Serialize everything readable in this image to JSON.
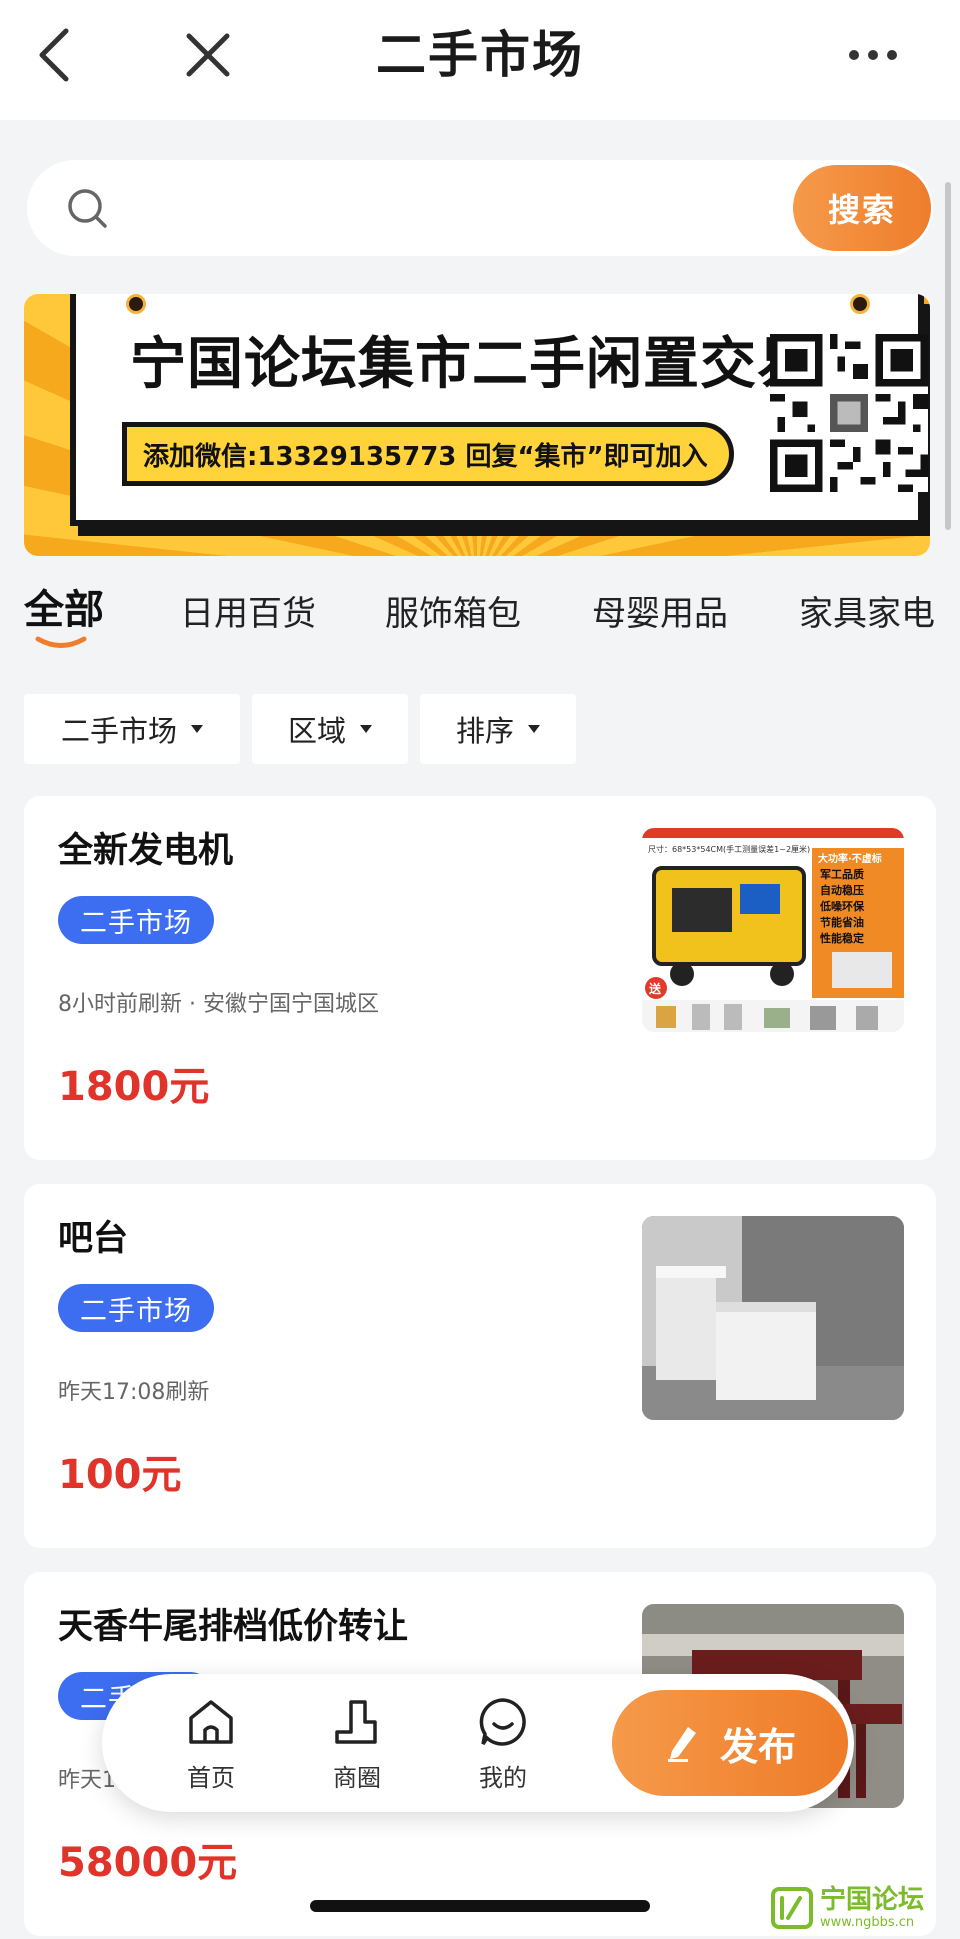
{
  "header": {
    "title": "二手市场"
  },
  "search": {
    "placeholder": "",
    "button_label": "搜索"
  },
  "banner": {
    "title": "宁国论坛集市二手闲置交易群",
    "subtitle": "添加微信:13329135773 回复“集市”即可加入"
  },
  "categories": [
    {
      "label": "全部",
      "active": true
    },
    {
      "label": "日用百货",
      "active": false
    },
    {
      "label": "服饰箱包",
      "active": false
    },
    {
      "label": "母婴用品",
      "active": false
    },
    {
      "label": "家具家电",
      "active": false
    }
  ],
  "filters": [
    {
      "label": "二手市场"
    },
    {
      "label": "区域"
    },
    {
      "label": "排序"
    }
  ],
  "listings": [
    {
      "title": "全新发电机",
      "tag": "二手市场",
      "meta": "8小时前刷新 · 安徽宁国宁国城区",
      "price": "1800元",
      "thumb_labels": [
        "尺寸：68*53*54CM(手工测量误差1~2厘米)",
        "大功率·不虚标",
        "军工品质",
        "自动稳压",
        "低噪环保",
        "节能省油",
        "性能稳定",
        "送"
      ]
    },
    {
      "title": "吧台",
      "tag": "二手市场",
      "meta": "昨天17:08刷新",
      "price": "100元"
    },
    {
      "title": "天香牛尾排档低价转让",
      "tag": "二手市场",
      "meta": "昨天1",
      "price": "58000元"
    }
  ],
  "bottom_nav": {
    "home": "首页",
    "biz": "商圈",
    "mine": "我的",
    "publish": "发布"
  },
  "watermark": {
    "name": "宁国论坛",
    "url": "www.ngbbs.cn"
  },
  "colors": {
    "accent_orange": "#ee7d2c",
    "tag_blue": "#3d6df0",
    "price_red": "#e0332a"
  }
}
